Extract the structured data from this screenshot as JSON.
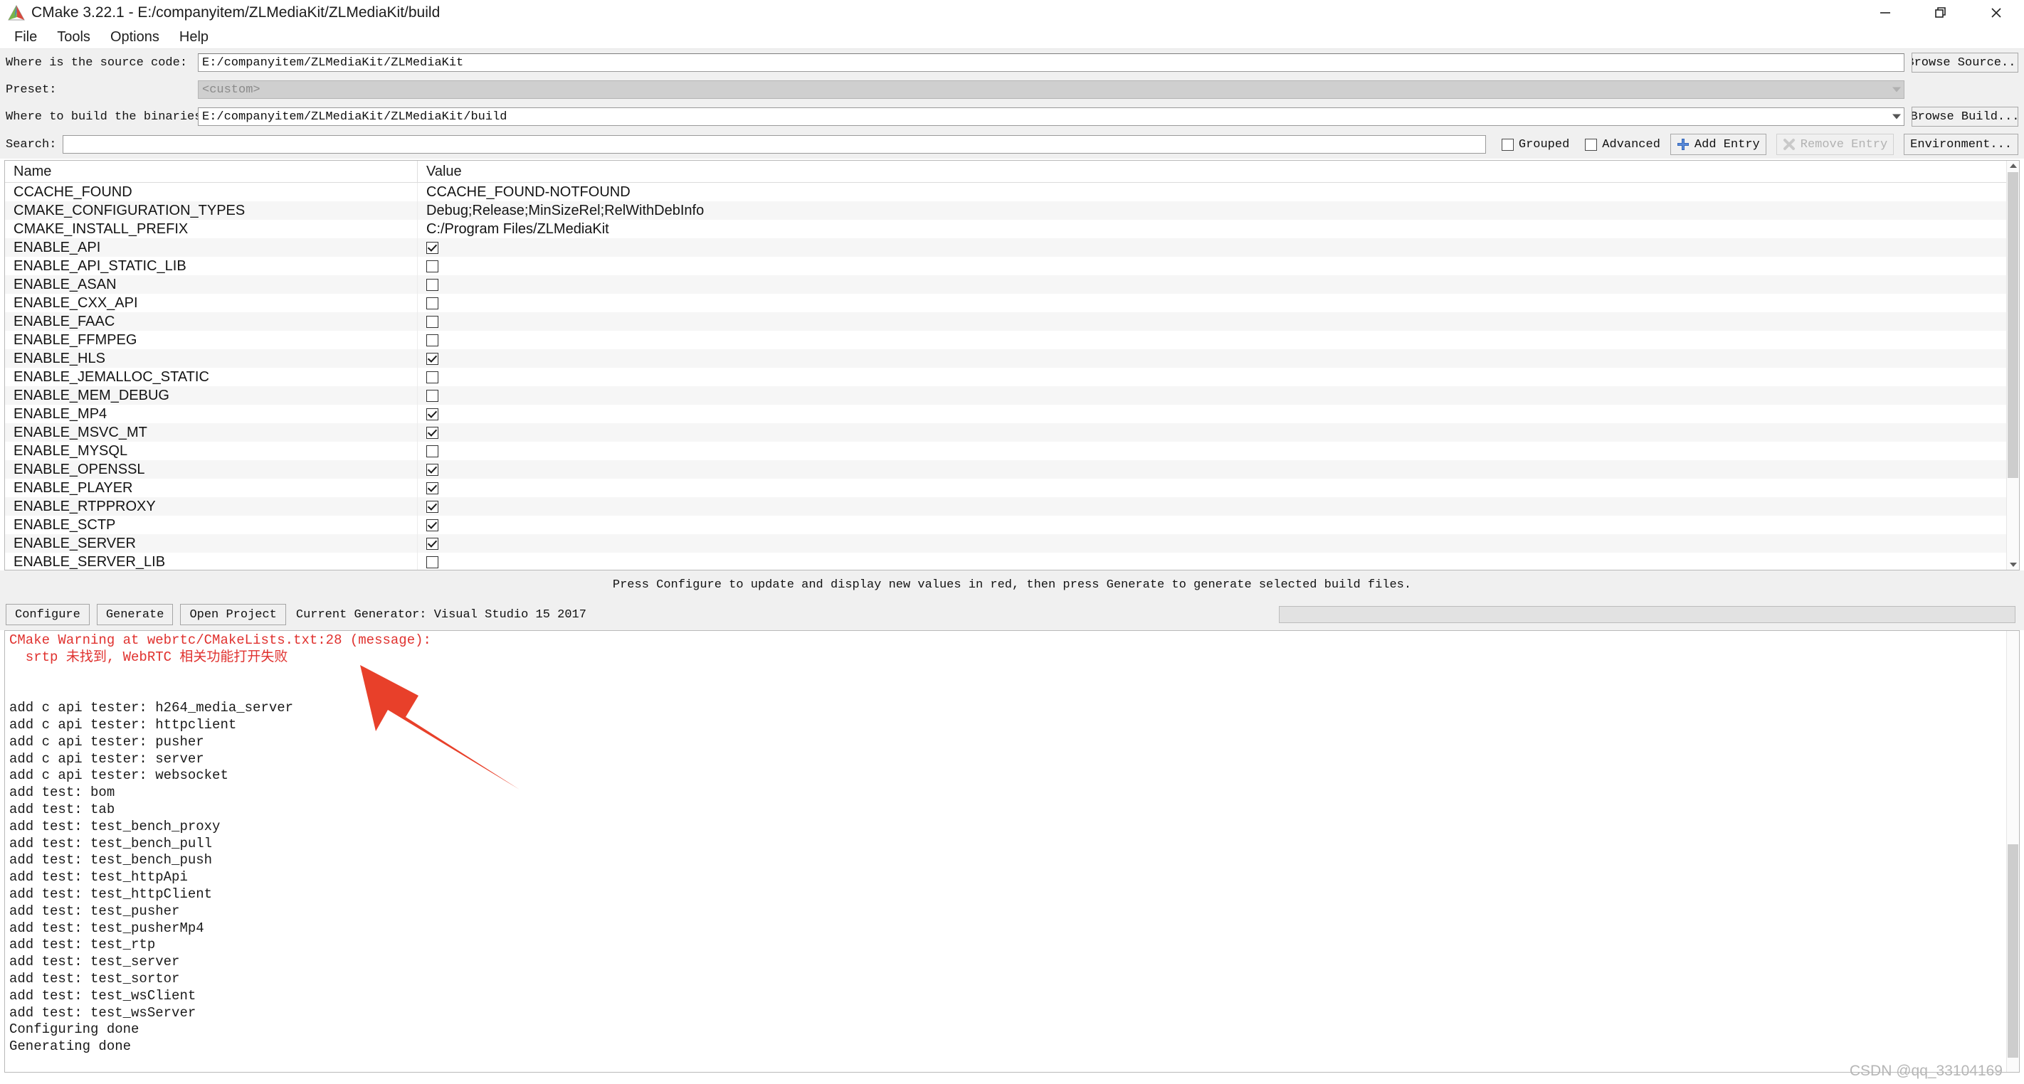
{
  "window": {
    "title": "CMake 3.22.1 - E:/companyitem/ZLMediaKit/ZLMediaKit/build",
    "app_icon": "cmake-triangle-icon",
    "minimize_label": "Minimize",
    "restore_label": "Restore",
    "close_label": "Close"
  },
  "menu": {
    "items": [
      {
        "label": "File"
      },
      {
        "label": "Tools"
      },
      {
        "label": "Options"
      },
      {
        "label": "Help"
      }
    ]
  },
  "form": {
    "source_label": "Where is the source code:",
    "source_value": "E:/companyitem/ZLMediaKit/ZLMediaKit",
    "browse_source_label": "Browse Source...",
    "preset_label": "Preset:",
    "preset_value": "<custom>",
    "binaries_label": "Where to build the binaries:",
    "binaries_value": "E:/companyitem/ZLMediaKit/ZLMediaKit/build",
    "browse_build_label": "Browse Build..."
  },
  "search": {
    "label": "Search:",
    "value": "",
    "placeholder": "",
    "grouped_label": "Grouped",
    "grouped_checked": false,
    "advanced_label": "Advanced",
    "advanced_checked": false,
    "add_entry_label": "Add Entry",
    "remove_entry_label": "Remove Entry",
    "environment_label": "Environment..."
  },
  "cache_table": {
    "columns": [
      "Name",
      "Value"
    ],
    "rows": [
      {
        "name": "CCACHE_FOUND",
        "type": "text",
        "value": "CCACHE_FOUND-NOTFOUND"
      },
      {
        "name": "CMAKE_CONFIGURATION_TYPES",
        "type": "text",
        "value": "Debug;Release;MinSizeRel;RelWithDebInfo"
      },
      {
        "name": "CMAKE_INSTALL_PREFIX",
        "type": "text",
        "value": "C:/Program Files/ZLMediaKit"
      },
      {
        "name": "ENABLE_API",
        "type": "checkbox",
        "checked": true
      },
      {
        "name": "ENABLE_API_STATIC_LIB",
        "type": "checkbox",
        "checked": false
      },
      {
        "name": "ENABLE_ASAN",
        "type": "checkbox",
        "checked": false
      },
      {
        "name": "ENABLE_CXX_API",
        "type": "checkbox",
        "checked": false
      },
      {
        "name": "ENABLE_FAAC",
        "type": "checkbox",
        "checked": false
      },
      {
        "name": "ENABLE_FFMPEG",
        "type": "checkbox",
        "checked": false
      },
      {
        "name": "ENABLE_HLS",
        "type": "checkbox",
        "checked": true
      },
      {
        "name": "ENABLE_JEMALLOC_STATIC",
        "type": "checkbox",
        "checked": false
      },
      {
        "name": "ENABLE_MEM_DEBUG",
        "type": "checkbox",
        "checked": false
      },
      {
        "name": "ENABLE_MP4",
        "type": "checkbox",
        "checked": true
      },
      {
        "name": "ENABLE_MSVC_MT",
        "type": "checkbox",
        "checked": true
      },
      {
        "name": "ENABLE_MYSQL",
        "type": "checkbox",
        "checked": false
      },
      {
        "name": "ENABLE_OPENSSL",
        "type": "checkbox",
        "checked": true
      },
      {
        "name": "ENABLE_PLAYER",
        "type": "checkbox",
        "checked": true
      },
      {
        "name": "ENABLE_RTPPROXY",
        "type": "checkbox",
        "checked": true
      },
      {
        "name": "ENABLE_SCTP",
        "type": "checkbox",
        "checked": true
      },
      {
        "name": "ENABLE_SERVER",
        "type": "checkbox",
        "checked": true
      },
      {
        "name": "ENABLE_SERVER_LIB",
        "type": "checkbox",
        "checked": false
      }
    ]
  },
  "hint": {
    "text": "Press Configure to update and display new values in red, then press Generate to generate selected build files."
  },
  "actions": {
    "configure_label": "Configure",
    "generate_label": "Generate",
    "open_project_label": "Open Project",
    "current_generator_label": "Current Generator: Visual Studio 15 2017",
    "progress_value": 0
  },
  "log": {
    "lines": [
      {
        "text": "CMake Warning at webrtc/CMakeLists.txt:28 (message):",
        "warn": true
      },
      {
        "text": "  srtp 未找到, WebRTC 相关功能打开失败",
        "warn": true
      },
      {
        "text": "",
        "warn": false
      },
      {
        "text": "",
        "warn": false
      },
      {
        "text": "add c api tester: h264_media_server",
        "warn": false
      },
      {
        "text": "add c api tester: httpclient",
        "warn": false
      },
      {
        "text": "add c api tester: pusher",
        "warn": false
      },
      {
        "text": "add c api tester: server",
        "warn": false
      },
      {
        "text": "add c api tester: websocket",
        "warn": false
      },
      {
        "text": "add test: bom",
        "warn": false
      },
      {
        "text": "add test: tab",
        "warn": false
      },
      {
        "text": "add test: test_bench_proxy",
        "warn": false
      },
      {
        "text": "add test: test_bench_pull",
        "warn": false
      },
      {
        "text": "add test: test_bench_push",
        "warn": false
      },
      {
        "text": "add test: test_httpApi",
        "warn": false
      },
      {
        "text": "add test: test_httpClient",
        "warn": false
      },
      {
        "text": "add test: test_pusher",
        "warn": false
      },
      {
        "text": "add test: test_pusherMp4",
        "warn": false
      },
      {
        "text": "add test: test_rtp",
        "warn": false
      },
      {
        "text": "add test: test_server",
        "warn": false
      },
      {
        "text": "add test: test_sortor",
        "warn": false
      },
      {
        "text": "add test: test_wsClient",
        "warn": false
      },
      {
        "text": "add test: test_wsServer",
        "warn": false
      },
      {
        "text": "Configuring done",
        "warn": false
      },
      {
        "text": "Generating done",
        "warn": false
      }
    ]
  },
  "annotation": {
    "arrow_color": "#e8402a",
    "arrow_name": "red-pointer-arrow"
  },
  "watermark": {
    "text": "CSDN @qq_33104169"
  },
  "colors": {
    "window_bg": "#f0f0f0",
    "field_bg": "#ffffff",
    "warn_red": "#e0322f",
    "accent_blue": "#2b5fb5"
  }
}
